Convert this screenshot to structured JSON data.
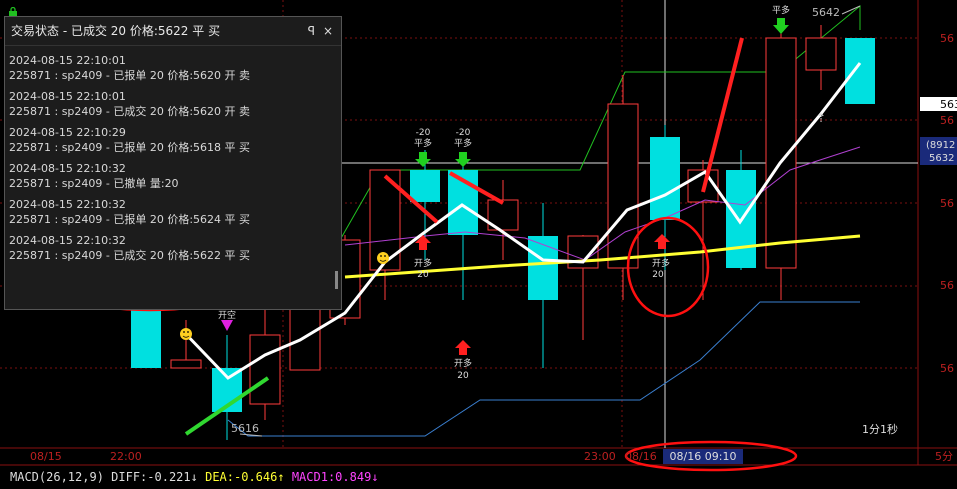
{
  "panel": {
    "title": "交易状态 - 已成交 20 价格:5622 平 买",
    "pin_glyph": "ꟼ",
    "close_glyph": "×",
    "entries": [
      {
        "time": "2024-08-15 22:10:01",
        "text": "225871 : sp2409 - 已报单 20 价格:5620 开 卖"
      },
      {
        "time": "2024-08-15 22:10:01",
        "text": "225871 : sp2409 - 已成交 20 价格:5620 开 卖"
      },
      {
        "time": "2024-08-15 22:10:29",
        "text": "225871 : sp2409 - 已报单 20 价格:5618 平 买"
      },
      {
        "time": "2024-08-15 22:10:32",
        "text": "225871 : sp2409 - 已撤单 量:20"
      },
      {
        "time": "2024-08-15 22:10:32",
        "text": "225871 : sp2409 - 已报单 20 价格:5624 平 买"
      },
      {
        "time": "2024-08-15 22:10:32",
        "text": "225871 : sp2409 - 已成交 20 价格:5622 平 买"
      }
    ]
  },
  "markers": {
    "close_long_1": {
      "qty": "-20",
      "label": "平多"
    },
    "close_long_2": {
      "qty": "-20",
      "label": "平多"
    },
    "close_long_top": {
      "qty": "20",
      "label": "平多"
    },
    "open_long_1": {
      "label": "开多",
      "qty": "20"
    },
    "open_long_2": {
      "label": "开多",
      "qty": "20"
    },
    "open_long_3": {
      "label": "开多",
      "qty": "20"
    },
    "open_short": {
      "label": "开空"
    },
    "low_price": "5616",
    "high_price": "5642"
  },
  "axis": {
    "right_labels": [
      "56",
      "56",
      "563",
      "(8912",
      "5632",
      "56",
      "56",
      "56"
    ],
    "time_labels": [
      "08/15",
      "22:00",
      "23:00",
      "08/16",
      "08/16 09:10"
    ],
    "period_right": "5分",
    "period_label": "1分1秒"
  },
  "macd": {
    "name": "MACD(26,12,9)",
    "diff": "DIFF:-0.221",
    "diff_arrow": "↓",
    "dea": "DEA:-0.646",
    "dea_arrow": "↑",
    "macd1": "MACD1:0.849",
    "macd1_arrow": "↓"
  },
  "colors": {
    "up": "#ff3b3b",
    "down": "#00e0e0",
    "ma_white": "#ffffff",
    "ma_yellow": "#ffff33",
    "ma_purple": "#b040d0",
    "grid": "#7a1010",
    "diff": "#ffffff",
    "dea": "#ffff33",
    "macd1": "#ff44ff"
  }
}
